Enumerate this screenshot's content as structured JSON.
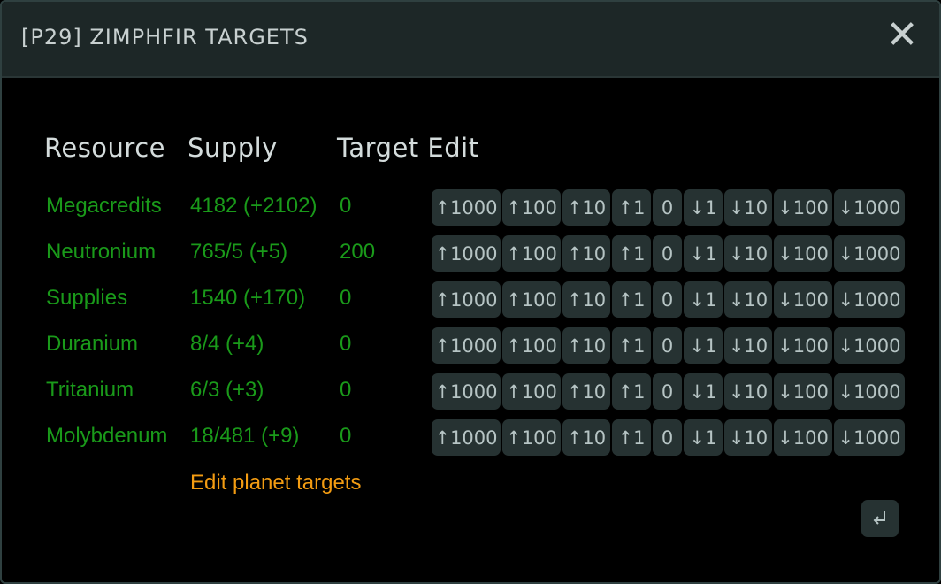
{
  "dialog": {
    "title": "[P29] ZIMPHFIR TARGETS",
    "close_icon": "close-icon"
  },
  "headers": {
    "resource": "Resource",
    "supply": "Supply",
    "target_edit": "Target Edit"
  },
  "rows": [
    {
      "resource": "Megacredits",
      "supply": "4182 (+2102)",
      "target": "0"
    },
    {
      "resource": "Neutronium",
      "supply": "765/5 (+5)",
      "target": "200"
    },
    {
      "resource": "Supplies",
      "supply": "1540 (+170)",
      "target": "0"
    },
    {
      "resource": "Duranium",
      "supply": "8/4 (+4)",
      "target": "0"
    },
    {
      "resource": "Tritanium",
      "supply": "6/3 (+3)",
      "target": "0"
    },
    {
      "resource": "Molybdenum",
      "supply": "18/481 (+9)",
      "target": "0"
    }
  ],
  "buttons": [
    "↑1000",
    "↑100",
    "↑10",
    "↑1",
    "0",
    "↓1",
    "↓10",
    "↓100",
    "↓1000"
  ],
  "link": "Edit planet targets",
  "colors": {
    "resource_text": "#1a9a1a",
    "link": "#f39c12",
    "button_bg": "#263232"
  }
}
